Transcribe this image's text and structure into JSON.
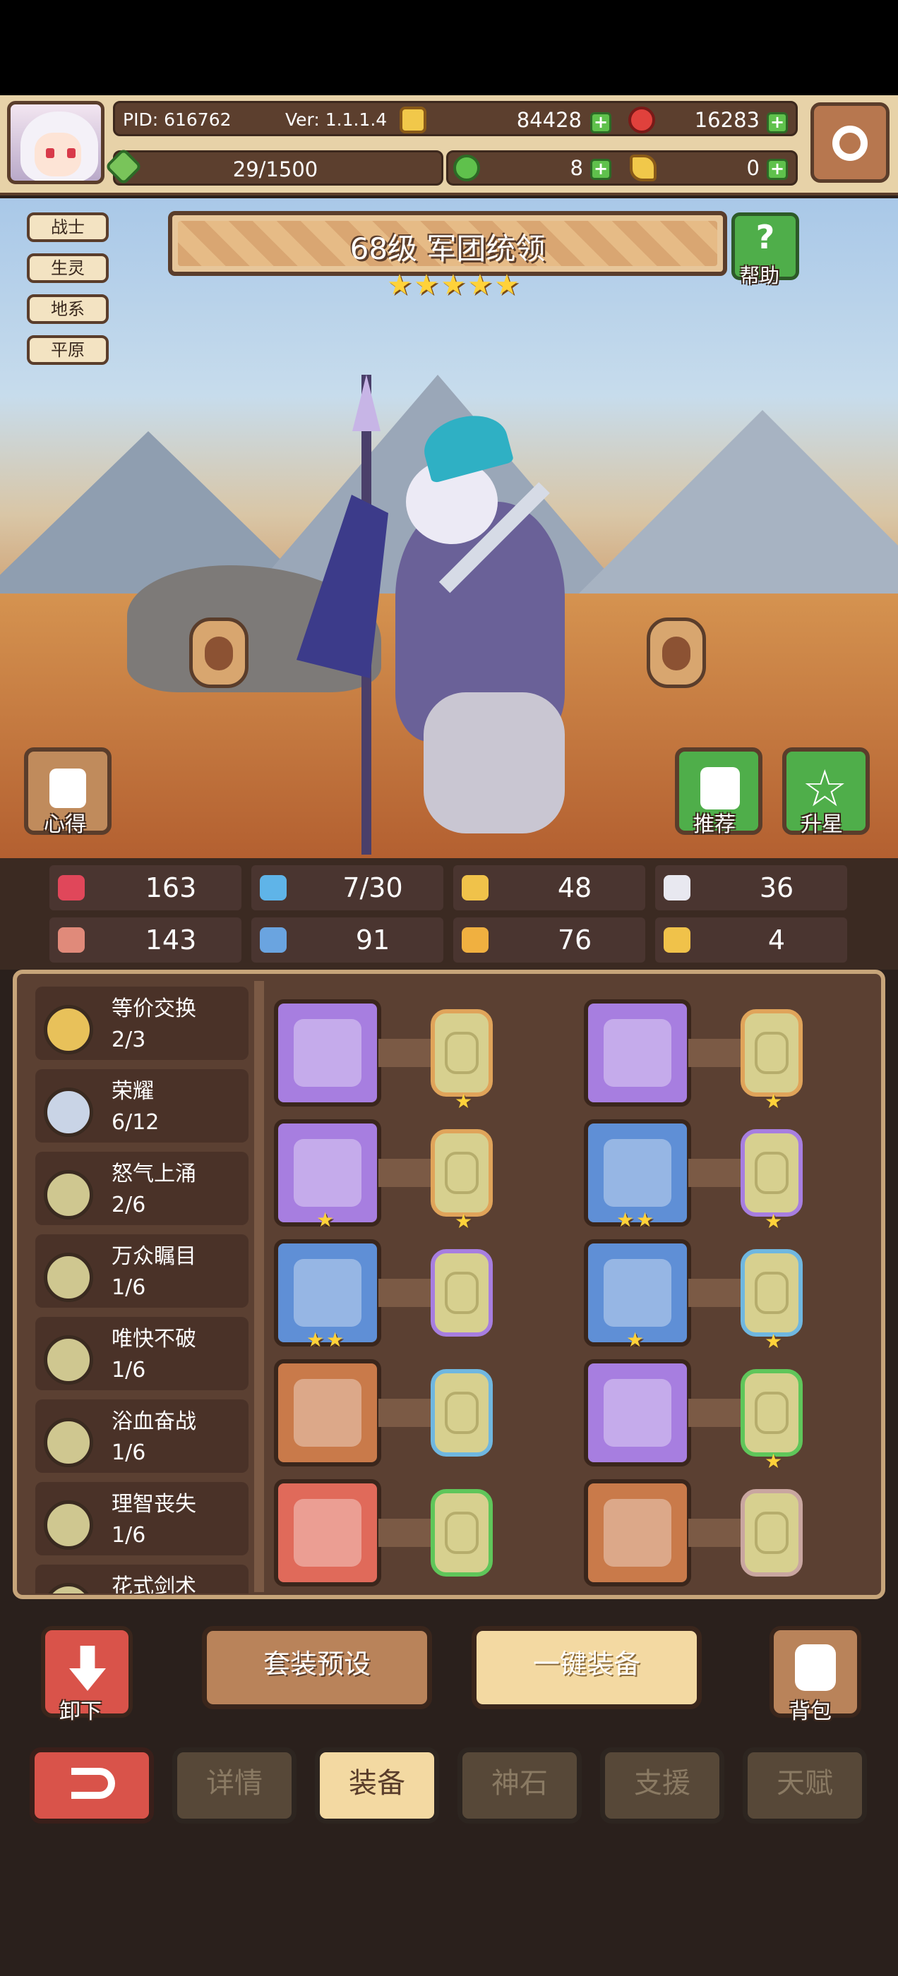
{
  "header": {
    "pid": "PID: 616762",
    "version": "Ver: 1.1.1.4",
    "gold": "84428",
    "gems": "16283",
    "stamina": "29/1500",
    "clover": "8",
    "key": "0"
  },
  "hero": {
    "title": "68级 军团统领",
    "stars": 5,
    "tags": [
      "战士",
      "生灵",
      "地系",
      "平原"
    ],
    "help_label": "帮助",
    "notes_label": "心得",
    "recommend_label": "推荐",
    "upgrade_label": "升星"
  },
  "stats": [
    {
      "icon": "heart-icon",
      "value": "163",
      "color": "#e0475a"
    },
    {
      "icon": "water-drop-icon",
      "value": "7/30",
      "color": "#5fb4e8"
    },
    {
      "icon": "shield-icon",
      "value": "48",
      "color": "#f0c24a"
    },
    {
      "icon": "wing-icon",
      "value": "36",
      "color": "#e8e8f0"
    },
    {
      "icon": "fist-icon",
      "value": "143",
      "color": "#e08a7a"
    },
    {
      "icon": "book-icon",
      "value": "91",
      "color": "#6aa4e0"
    },
    {
      "icon": "boots-icon",
      "value": "76",
      "color": "#f0b040"
    },
    {
      "icon": "horseshoe-icon",
      "value": "4",
      "color": "#f0c24a"
    }
  ],
  "sets": [
    {
      "name": "等价交换",
      "count": "2/3",
      "color": "#e8c15a"
    },
    {
      "name": "荣耀",
      "count": "6/12",
      "color": "#c9d4e6"
    },
    {
      "name": "怒气上涌",
      "count": "2/6",
      "color": "#cfc790"
    },
    {
      "name": "万众瞩目",
      "count": "1/6",
      "color": "#cfc790"
    },
    {
      "name": "唯快不破",
      "count": "1/6",
      "color": "#cfc790"
    },
    {
      "name": "浴血奋战",
      "count": "1/6",
      "color": "#cfc790"
    },
    {
      "name": "理智丧失",
      "count": "1/6",
      "color": "#cfc790"
    },
    {
      "name": "花式剑术",
      "count": "",
      "color": "#cfc790"
    }
  ],
  "equipment": [
    {
      "item": "staff-icon",
      "rarity": "#a77ee0",
      "item_stars": 0,
      "rune_border": "#e0a45a",
      "rune_stars": 1
    },
    {
      "item": "helmet-icon",
      "rarity": "#a77ee0",
      "item_stars": 0,
      "rune_border": "#e0a45a",
      "rune_stars": 1
    },
    {
      "item": "amulet-icon",
      "rarity": "#a77ee0",
      "item_stars": 1,
      "rune_border": "#e0a45a",
      "rune_stars": 1
    },
    {
      "item": "armor-icon",
      "rarity": "#5f8fd6",
      "item_stars": 2,
      "rune_border": "#a77ee0",
      "rune_stars": 1
    },
    {
      "item": "necklace-icon",
      "rarity": "#5f8fd6",
      "item_stars": 2,
      "rune_border": "#a77ee0",
      "rune_stars": 0
    },
    {
      "item": "bracer-icon",
      "rarity": "#5f8fd6",
      "item_stars": 1,
      "rune_border": "#6fb7e0",
      "rune_stars": 1
    },
    {
      "item": "gem-brooch-icon",
      "rarity": "#c97a4a",
      "item_stars": 0,
      "rune_border": "#6fb7e0",
      "rune_stars": 0
    },
    {
      "item": "gloves-icon",
      "rarity": "#a77ee0",
      "item_stars": 0,
      "rune_border": "#5fc65a",
      "rune_stars": 1
    },
    {
      "item": "pot-icon",
      "rarity": "#e06a5a",
      "item_stars": 0,
      "rune_border": "#5fc65a",
      "rune_stars": 0
    },
    {
      "item": "boots-icon",
      "rarity": "#c97a4a",
      "item_stars": 0,
      "rune_border": "#c9a6a0",
      "rune_stars": 0
    }
  ],
  "actions": {
    "unequip": "卸下",
    "preset": "套装预设",
    "auto_equip": "一键装备",
    "bag": "背包"
  },
  "tabs": [
    "详情",
    "装备",
    "神石",
    "支援",
    "天赋"
  ],
  "active_tab": "装备"
}
